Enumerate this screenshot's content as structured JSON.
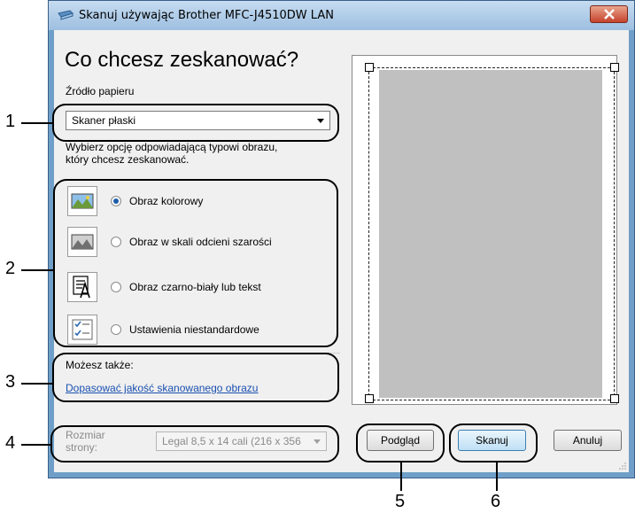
{
  "window": {
    "title": "Skanuj używając Brother MFC-J4510DW LAN"
  },
  "heading": "Co chcesz zeskanować?",
  "paper_source": {
    "label": "Źródło papieru",
    "value": "Skaner płaski"
  },
  "instruction": {
    "line1": "Wybierz opcję odpowiadającą typowi obrazu,",
    "line2": "który chcesz zeskanować."
  },
  "options": [
    {
      "label": "Obraz kolorowy",
      "selected": true
    },
    {
      "label": "Obraz w skali odcieni szarości",
      "selected": false
    },
    {
      "label": "Obraz czarno-biały lub tekst",
      "selected": false
    },
    {
      "label": "Ustawienia niestandardowe",
      "selected": false
    }
  ],
  "also": {
    "label": "Możesz także:",
    "link": "Dopasować jakość skanowanego obrazu"
  },
  "page_size": {
    "label_line1": "Rozmiar",
    "label_line2": "strony:",
    "value": "Legal 8,5 x 14 cali (216 x 356"
  },
  "buttons": {
    "preview": "Podgląd",
    "scan": "Skanuj",
    "cancel": "Anuluj"
  },
  "callouts": [
    "1",
    "2",
    "3",
    "4",
    "5",
    "6"
  ],
  "colors": {
    "accent": "#1c5ea8",
    "link": "#1a50b0"
  }
}
